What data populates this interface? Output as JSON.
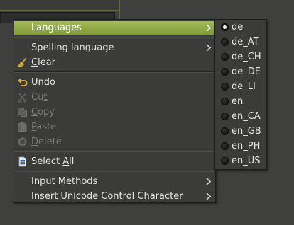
{
  "colors": {
    "menu_bg": "#3b3b39",
    "highlight": "#8fa848",
    "text": "#e6e6e6",
    "disabled_text": "#7b7b78"
  },
  "menu": {
    "languages": "Languages",
    "spelling_language": "Spelling language",
    "clear": "Clear",
    "undo": "Undo",
    "cut": "Cut",
    "copy": "Copy",
    "paste": "Paste",
    "delete": "Delete",
    "select_all": "Select All",
    "input_methods": "Input Methods",
    "insert_unicode": "Insert Unicode Control Character"
  },
  "icons": {
    "clear": "broom-icon",
    "undo": "undo-arrow-icon",
    "cut": "scissors-icon",
    "copy": "copy-icon",
    "paste": "paste-icon",
    "delete": "delete-icon",
    "select_all": "select-all-document-icon",
    "submenu": "chevron-right-icon"
  },
  "languages_submenu": {
    "selected": "de",
    "items": [
      "de",
      "de_AT",
      "de_CH",
      "de_DE",
      "de_LI",
      "en",
      "en_CA",
      "en_GB",
      "en_PH",
      "en_US"
    ]
  }
}
